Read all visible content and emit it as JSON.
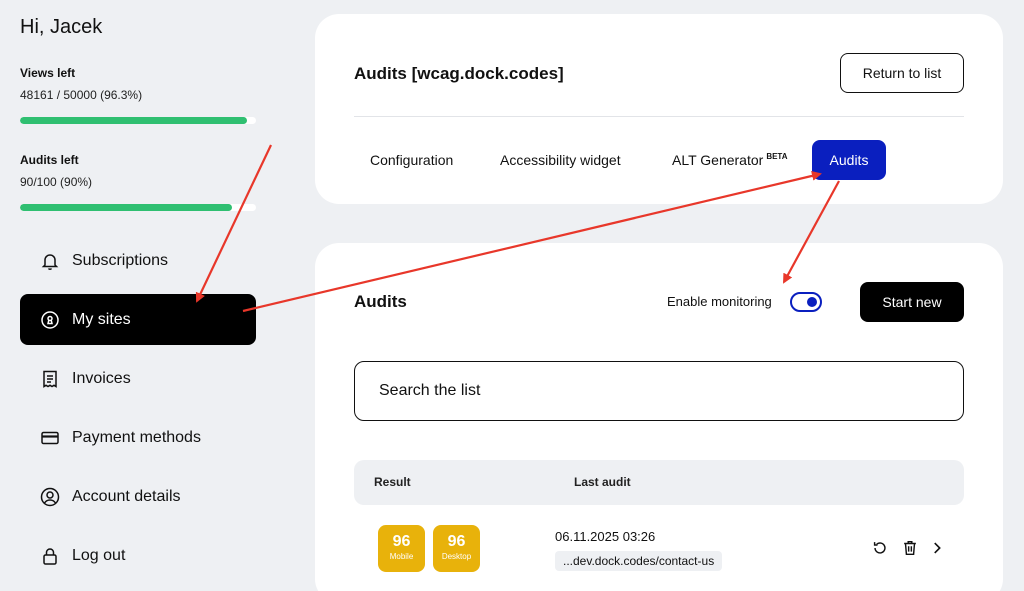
{
  "sidebar": {
    "greeting": "Hi, Jacek",
    "views": {
      "label": "Views left",
      "value": "48161 / 50000 (96.3%)",
      "fraction": 0.963
    },
    "audits": {
      "label": "Audits left",
      "value": "90/100 (90%)",
      "fraction": 0.9
    },
    "items": [
      {
        "label": "Subscriptions",
        "icon": "bell-icon",
        "active": false
      },
      {
        "label": "My sites",
        "icon": "site-icon",
        "active": true
      },
      {
        "label": "Invoices",
        "icon": "invoice-icon",
        "active": false
      },
      {
        "label": "Payment methods",
        "icon": "credit-card-icon",
        "active": false
      },
      {
        "label": "Account details",
        "icon": "user-icon",
        "active": false
      },
      {
        "label": "Log out",
        "icon": "lock-icon",
        "active": false
      }
    ]
  },
  "header": {
    "title": "Audits [wcag.dock.codes]",
    "return_button": "Return to list",
    "tabs": [
      {
        "label": "Configuration",
        "active": false
      },
      {
        "label": "Accessibility widget",
        "active": false
      },
      {
        "label": "ALT Generator",
        "badge": "BETA",
        "active": false
      },
      {
        "label": "Audits",
        "active": true
      }
    ]
  },
  "main": {
    "title": "Audits",
    "monitoring_label": "Enable monitoring",
    "monitoring_on": true,
    "start_button": "Start new",
    "search_placeholder": "Search the list",
    "columns": [
      "Result",
      "Last audit"
    ],
    "rows": [
      {
        "mobile_score": "96",
        "mobile_label": "Mobile",
        "desktop_score": "96",
        "desktop_label": "Desktop",
        "date": "06.11.2025 03:26",
        "url": "...dev.dock.codes/contact-us"
      }
    ]
  },
  "colors": {
    "accent": "#0a1fbf",
    "progress": "#2fbf71",
    "score": "#e8b20b",
    "annotation_arrow": "#e8372a"
  }
}
